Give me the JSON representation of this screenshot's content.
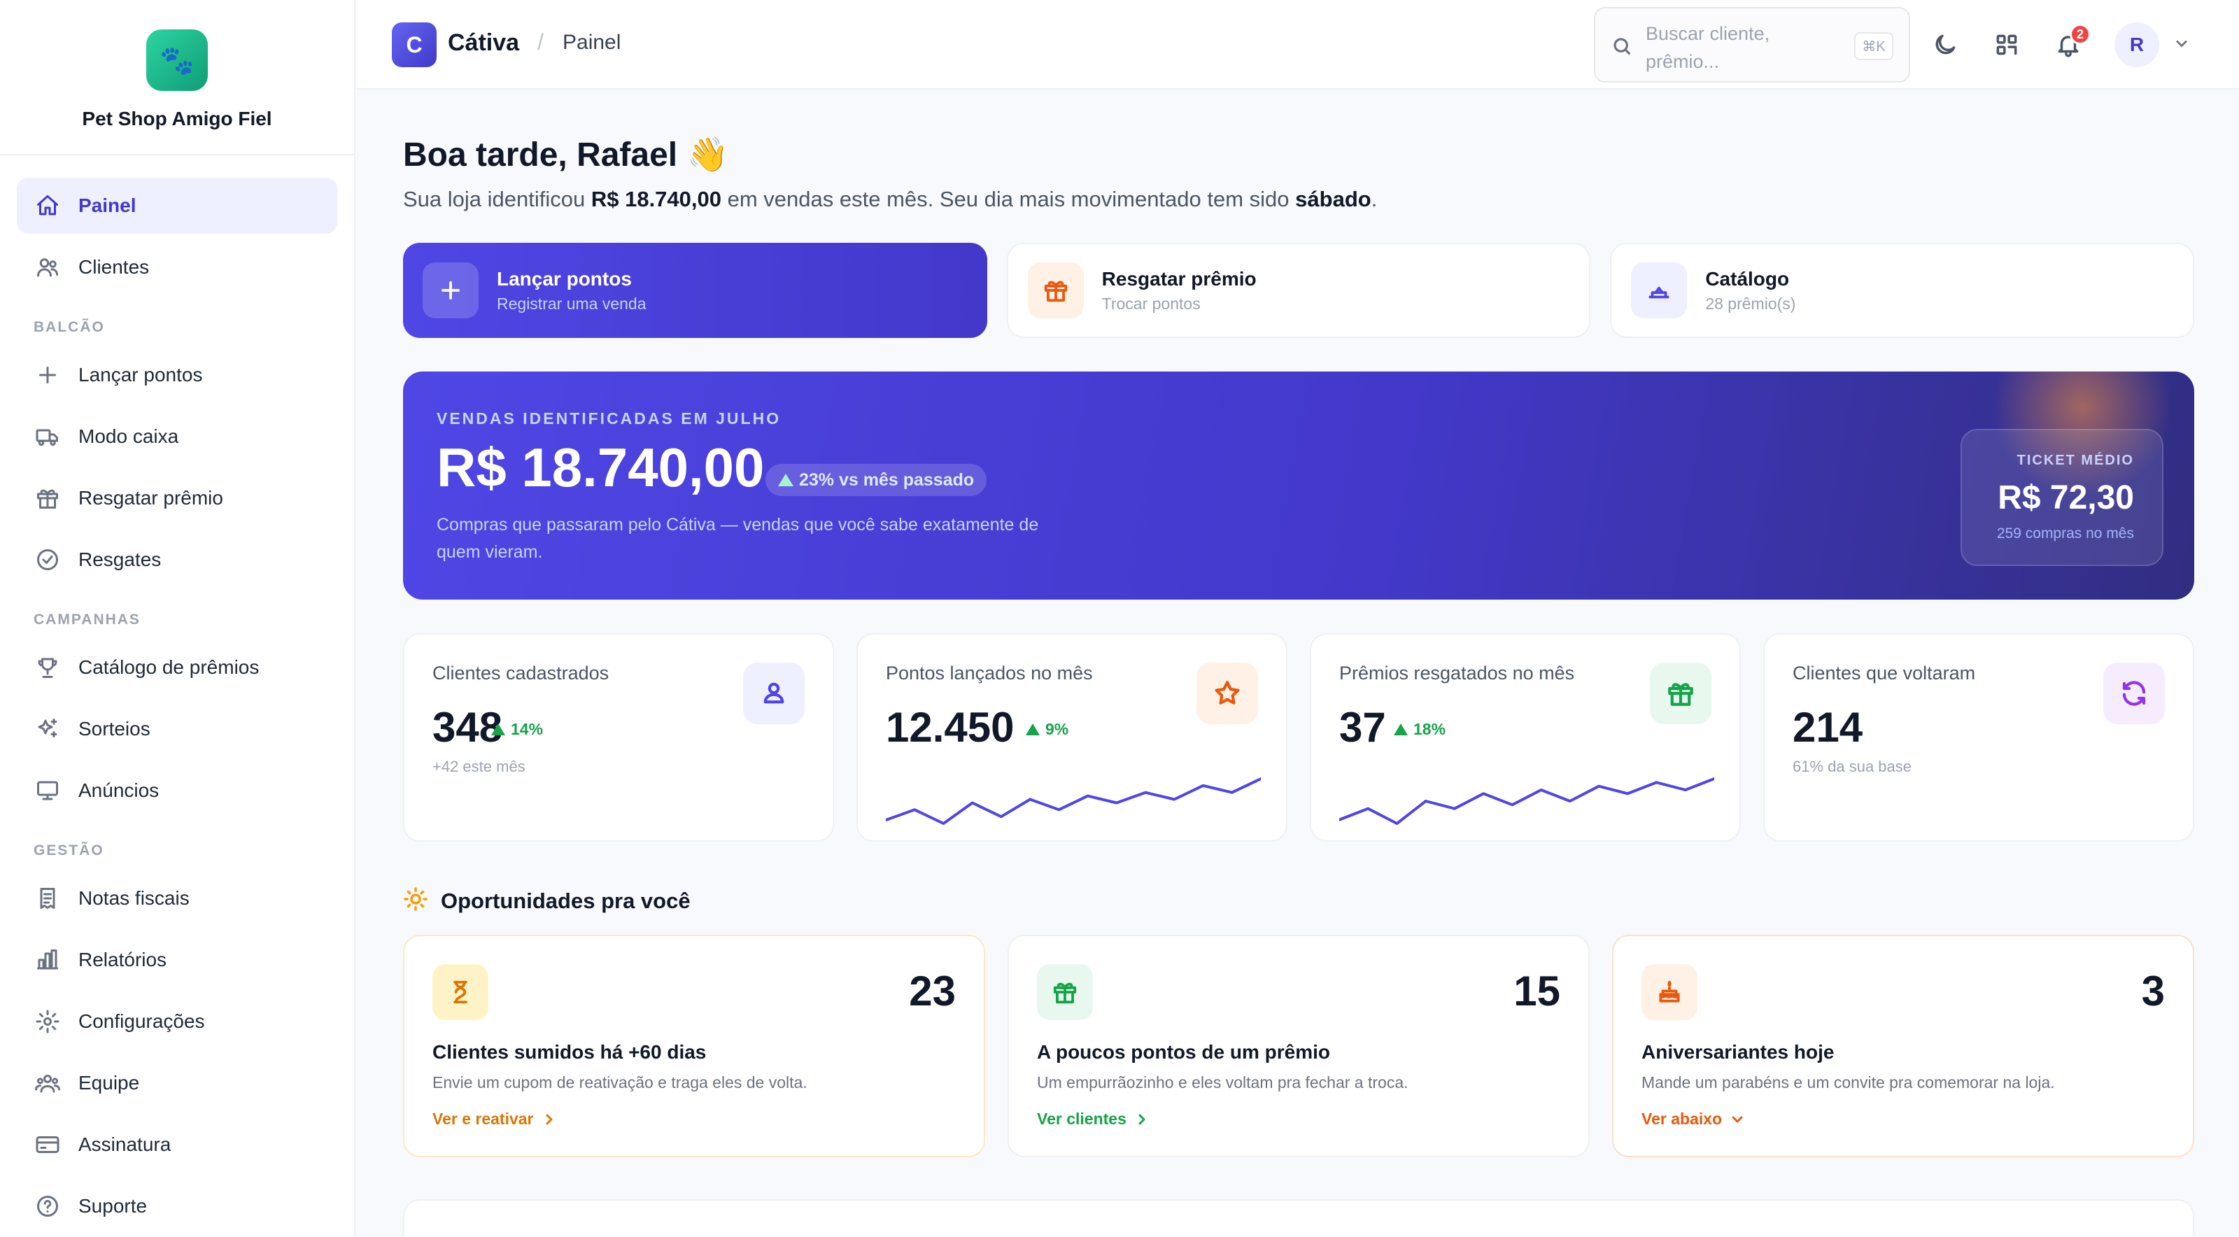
{
  "brand": {
    "name": "Pet Shop Amigo Fiel",
    "logo_icon": "paw-icon"
  },
  "sidebar": {
    "main": [
      {
        "label": "Painel",
        "icon": "home-icon",
        "active": true
      },
      {
        "label": "Clientes",
        "icon": "users-icon"
      }
    ],
    "sections": [
      {
        "title": "BALCÃO",
        "items": [
          {
            "label": "Lançar pontos",
            "icon": "plus-icon"
          },
          {
            "label": "Modo caixa",
            "icon": "truck-icon"
          },
          {
            "label": "Resgatar prêmio",
            "icon": "gift-icon"
          },
          {
            "label": "Resgates",
            "icon": "check-circle-icon"
          }
        ]
      },
      {
        "title": "CAMPANHAS",
        "items": [
          {
            "label": "Catálogo de prêmios",
            "icon": "trophy-icon"
          },
          {
            "label": "Sorteios",
            "icon": "sparkles-icon"
          },
          {
            "label": "Anúncios",
            "icon": "monitor-icon"
          }
        ]
      },
      {
        "title": "GESTÃO",
        "items": [
          {
            "label": "Notas fiscais",
            "icon": "receipt-icon"
          },
          {
            "label": "Relatórios",
            "icon": "bar-chart-icon"
          },
          {
            "label": "Configurações",
            "icon": "gear-icon"
          },
          {
            "label": "Equipe",
            "icon": "team-icon"
          },
          {
            "label": "Assinatura",
            "icon": "credit-card-icon"
          },
          {
            "label": "Suporte",
            "icon": "help-icon"
          }
        ]
      }
    ]
  },
  "topbar": {
    "logo_letter": "C",
    "app_name": "Cátiva",
    "separator": "/",
    "breadcrumb": "Painel",
    "search_placeholder": "Buscar cliente, prêmio...",
    "search_shortcut": "⌘K",
    "notifications_count": "2",
    "avatar_initial": "R"
  },
  "greeting": {
    "title": "Boa tarde, Rafael 👋",
    "subtitle_pre": "Sua loja identificou ",
    "subtitle_amount": "R$ 18.740,00",
    "subtitle_mid": " em vendas este mês. Seu dia mais movimentado tem sido ",
    "subtitle_day": "sábado",
    "subtitle_end": "."
  },
  "quick_actions": [
    {
      "title": "Lançar pontos",
      "subtitle": "Registrar uma venda",
      "icon": "plus-icon"
    },
    {
      "title": "Resgatar prêmio",
      "subtitle": "Trocar pontos",
      "icon": "gift-icon"
    },
    {
      "title": "Catálogo",
      "subtitle": "28 prêmio(s)",
      "icon": "podium-icon"
    }
  ],
  "hero": {
    "label": "VENDAS IDENTIFICADAS EM JULHO",
    "amount": "R$ 18.740,00",
    "change": "23% vs mês passado",
    "description": "Compras que passaram pelo Cátiva — vendas que você sabe exatamente de quem vieram.",
    "ticket_label": "TICKET MÉDIO",
    "ticket_value": "R$ 72,30",
    "ticket_sub": "259 compras no mês"
  },
  "stats": [
    {
      "label": "Clientes cadastrados",
      "value": "348",
      "delta": "14%",
      "note": "+42 este mês",
      "icon": "user-icon",
      "color": "#4f46e5",
      "bg": "#eef0ff"
    },
    {
      "label": "Pontos lançados no mês",
      "value": "12.450",
      "delta": "9%",
      "note": "",
      "icon": "star-icon",
      "color": "#ea580c",
      "bg": "#fff1e6"
    },
    {
      "label": "Prêmios resgatados no mês",
      "value": "37",
      "delta": "18%",
      "note": "",
      "icon": "gift-icon",
      "color": "#16a34a",
      "bg": "#e8f8ee"
    },
    {
      "label": "Clientes que voltaram",
      "value": "214",
      "delta": "",
      "note": "61% da sua base",
      "icon": "refresh-icon",
      "color": "#9333ea",
      "bg": "#f5ecfe"
    }
  ],
  "opportunities": {
    "title": "Oportunidades pra você",
    "icon": "sun-icon",
    "cards": [
      {
        "count": "23",
        "title": "Clientes sumidos há +60 dias",
        "description": "Envie um cupom de reativação e traga eles de volta.",
        "link": "Ver e reativar",
        "icon": "hourglass-icon",
        "link_icon": "chevron-right-icon",
        "color": "#d97706",
        "bg": "#fef3c7"
      },
      {
        "count": "15",
        "title": "A poucos pontos de um prêmio",
        "description": "Um empurrãozinho e eles voltam pra fechar a troca.",
        "link": "Ver clientes",
        "icon": "gift-icon",
        "link_icon": "chevron-right-icon",
        "color": "#16a34a",
        "bg": "#e8f8ee"
      },
      {
        "count": "3",
        "title": "Aniversariantes hoje",
        "description": "Mande um parabéns e um convite pra comemorar na loja.",
        "link": "Ver abaixo",
        "icon": "cake-icon",
        "link_icon": "chevron-down-icon",
        "color": "#ea580c",
        "bg": "#fff1e6"
      }
    ]
  },
  "chart_data": [
    {
      "type": "line",
      "title": "",
      "series": [
        {
          "values": [
            10,
            13,
            9,
            15,
            11,
            16,
            13,
            17,
            15,
            18,
            16,
            20,
            18,
            22
          ]
        }
      ]
    },
    {
      "type": "line",
      "title": "",
      "series": [
        {
          "values": [
            9,
            12,
            8,
            14,
            12,
            16,
            13,
            17,
            14,
            18,
            16,
            19,
            17,
            20
          ]
        }
      ]
    }
  ]
}
